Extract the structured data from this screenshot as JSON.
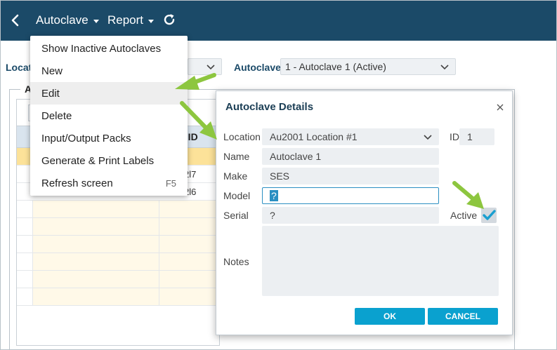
{
  "topbar": {
    "nav": [
      {
        "label": "Autoclave"
      },
      {
        "label": "Report"
      }
    ]
  },
  "filters": {
    "location_label": "Locat",
    "autoclave_label": "Autoclave",
    "autoclave_value": "1 - Autoclave 1 (Active)"
  },
  "panel": {
    "tab_label": "A",
    "grid_header": "e ID",
    "rows": [
      {
        "value": ""
      },
      {
        "value": "2l7"
      },
      {
        "value": "2l6"
      }
    ],
    "dots": [
      "·",
      "·",
      "·"
    ]
  },
  "menu": {
    "items": [
      {
        "label": "Show Inactive Autoclaves",
        "shortcut": ""
      },
      {
        "label": "New",
        "shortcut": ""
      },
      {
        "label": "Edit",
        "shortcut": ""
      },
      {
        "label": "Delete",
        "shortcut": ""
      },
      {
        "label": "Input/Output Packs",
        "shortcut": ""
      },
      {
        "label": "Generate & Print Labels",
        "shortcut": ""
      },
      {
        "label": "Refresh screen",
        "shortcut": "F5"
      }
    ]
  },
  "dialog": {
    "title": "Autoclave Details",
    "fields": {
      "location": {
        "label": "Location",
        "value": "Au2001 Location #1"
      },
      "id": {
        "label": "ID",
        "value": "1"
      },
      "name": {
        "label": "Name",
        "value": "Autoclave 1"
      },
      "make": {
        "label": "Make",
        "value": "SES"
      },
      "model": {
        "label": "Model",
        "value": "?"
      },
      "serial": {
        "label": "Serial",
        "value": "?"
      },
      "active": {
        "label": "Active",
        "checked": true
      },
      "notes": {
        "label": "Notes",
        "value": ""
      }
    },
    "ok_label": "OK",
    "cancel_label": "CANCEL"
  },
  "colors": {
    "topbar": "#1b4a68",
    "accent_button": "#0aa1cf",
    "checkmark": "#1a9fd0",
    "arrow": "#8dc63f",
    "selected_row": "#fce299"
  },
  "icons": {
    "back": "chevron-left-icon",
    "refresh": "refresh-icon",
    "close": "close-icon",
    "dropdown": "chevron-down-icon",
    "check": "checkmark-icon"
  }
}
